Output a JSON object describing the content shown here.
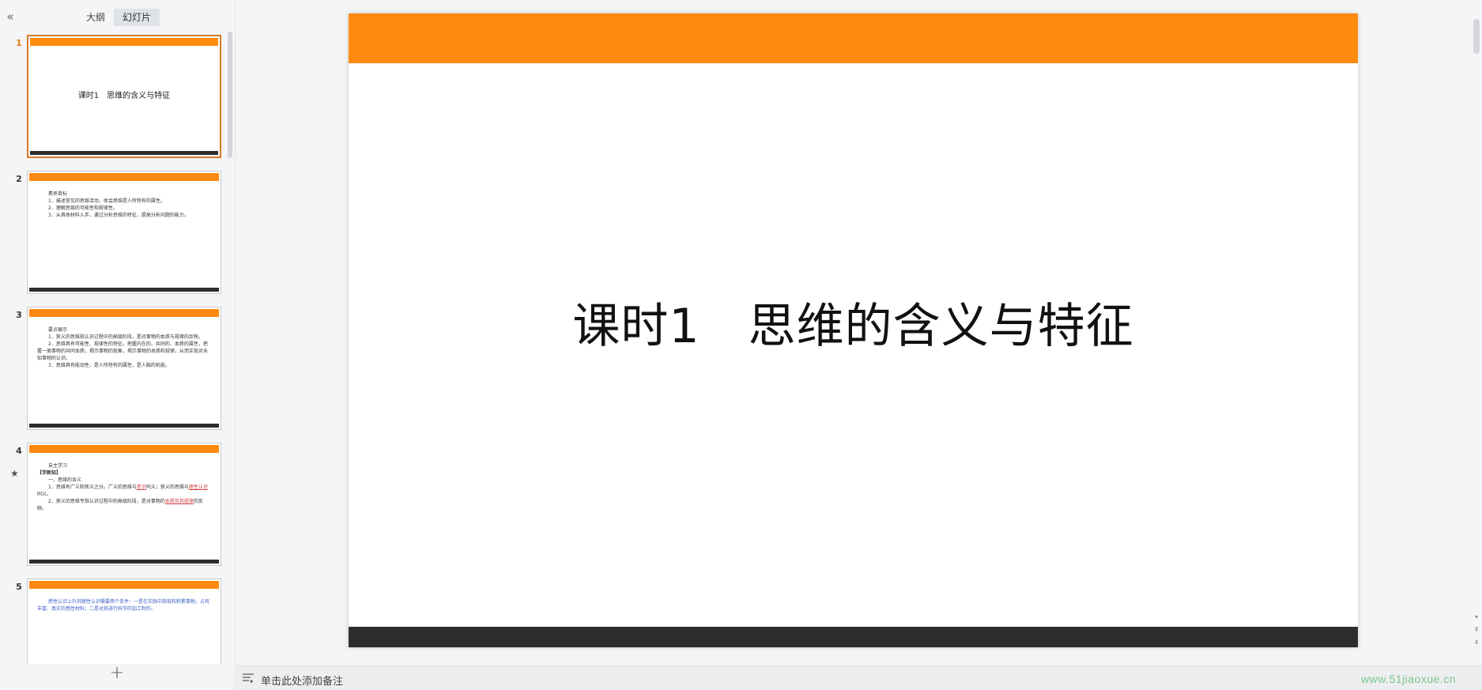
{
  "left_panel": {
    "collapse_icon": "double-chevron-left-icon",
    "tabs": [
      {
        "label": "大纲",
        "active": false
      },
      {
        "label": "幻灯片",
        "active": true
      }
    ],
    "add_icon": "plus-icon"
  },
  "slides": [
    {
      "number": "1",
      "title": "课时1　思维的含义与特征"
    },
    {
      "number": "2",
      "lines": [
        "素养目标",
        "1．描述常见的思维活动，体会思维是人所特有的属性。",
        "2．理解思维的可能性和规律性。",
        "3．从具体材料入手，通过分析思维的特征，提高分析问题的能力。"
      ]
    },
    {
      "number": "3",
      "lines": [
        "要点展示",
        "1．狭义的思维指认识过程中的高级阶段，是对事物的本质与规律的反映。",
        "2．思维具有可能性、规律性的特征。把握内在的、共同的、本质的属性，把握一类事物的共同本质，揭示事物的现象，揭示事物的本质和规律，从而实现对未知事物的认识。",
        "3．思维具有能动性，是人所特有的属性，是人脑的机能。"
      ]
    },
    {
      "number": "4",
      "star_icon": "star-icon",
      "lines": [
        "自主学习",
        "【学新知】",
        "一、思维的含义",
        "1．思维有广义和狭义之分。广义的思维与",
        "意识",
        "同义；狭义的思维与",
        "理性认识",
        "同义。",
        "2．狭义的思维专指认识过程中的高级阶段，是对事物的",
        "本质及其规律",
        "的反映。"
      ]
    },
    {
      "number": "5",
      "lines": [
        "感性认识上升到理性认识需要两个条件：一是在实践中获取和积累事物，占有丰富、真实的感性材料；二是对其进行科学的加工制作。"
      ]
    }
  ],
  "main_slide": {
    "title": "课时1　思维的含义与特征"
  },
  "notes": {
    "icon": "notes-list-icon",
    "placeholder": "单击此处添加备注"
  },
  "watermark": "www.51jiaoxue.cn",
  "colors": {
    "accent_orange": "#ff8a0f",
    "bottom_bar": "#2d2d2d",
    "selection_border": "#d47a2a"
  }
}
